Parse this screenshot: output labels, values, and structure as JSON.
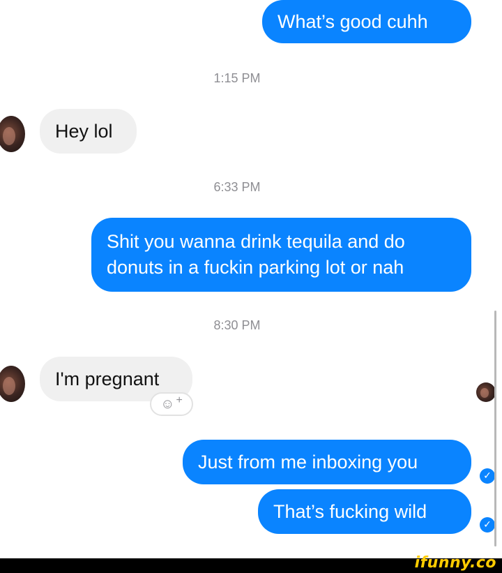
{
  "messages": [
    {
      "text": "What’s good cuhh"
    },
    {
      "text": "Hey lol"
    },
    {
      "text": "Shit you wanna drink tequila and do donuts in a fuckin parking lot or nah"
    },
    {
      "text": "I'm pregnant"
    },
    {
      "text": "Just from me inboxing you"
    },
    {
      "text": "That’s fucking wild"
    }
  ],
  "timestamps": [
    "1:15 PM",
    "6:33 PM",
    "8:30 PM"
  ],
  "reaction_button": {
    "icon": "☺",
    "plus": "+"
  },
  "watermark": "ifunny.co",
  "colors": {
    "outgoing": "#0a84ff",
    "incoming": "#f0f0f0",
    "timestamp": "#8e8e93"
  }
}
